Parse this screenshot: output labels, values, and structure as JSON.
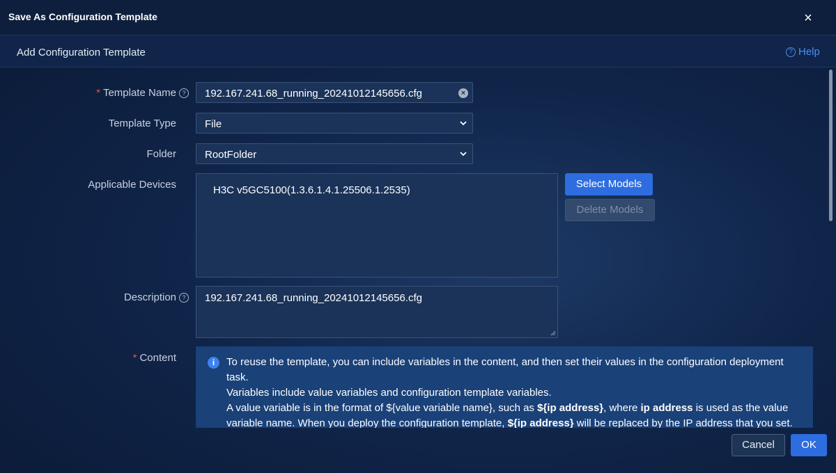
{
  "dialog": {
    "title": "Save As Configuration Template",
    "close_glyph": "×"
  },
  "subheader": {
    "title": "Add Configuration Template",
    "help_label": "Help",
    "help_icon": "?"
  },
  "form": {
    "template_name": {
      "required_mark": "*",
      "label": "Template Name",
      "hint_icon": "?",
      "value": "192.167.241.68_running_20241012145656.cfg",
      "clear_glyph": "×"
    },
    "template_type": {
      "label": "Template Type",
      "value": "File"
    },
    "folder": {
      "label": "Folder",
      "value": "RootFolder"
    },
    "applicable_devices": {
      "label": "Applicable Devices",
      "items": [
        "H3C v5GC5100(1.3.6.1.4.1.25506.1.2535)"
      ],
      "select_button": "Select Models",
      "delete_button": "Delete Models"
    },
    "description": {
      "label": "Description",
      "hint_icon": "?",
      "value": "192.167.241.68_running_20241012145656.cfg"
    },
    "content": {
      "required_mark": "*",
      "label": "Content",
      "info_icon": "i",
      "info": {
        "line1": "To reuse the template, you can include variables in the content, and then set their values in the configuration deployment task.",
        "line2": "Variables include value variables and configuration template variables.",
        "line3_a": "A value variable is in the format of ${value variable name}, such as ",
        "line3_b": "${ip address}",
        "line3_c": ", where ",
        "line3_d": "ip address",
        "line3_e": " is used as the value variable name. When you deploy the configuration template, ",
        "line3_f": "${ip address}",
        "line3_g": " will be replaced by the IP address that you set."
      }
    }
  },
  "footer": {
    "cancel_label": "Cancel",
    "ok_label": "OK"
  },
  "colors": {
    "accent": "#2d6de0",
    "required": "#e5533b",
    "background": "#10254a"
  }
}
